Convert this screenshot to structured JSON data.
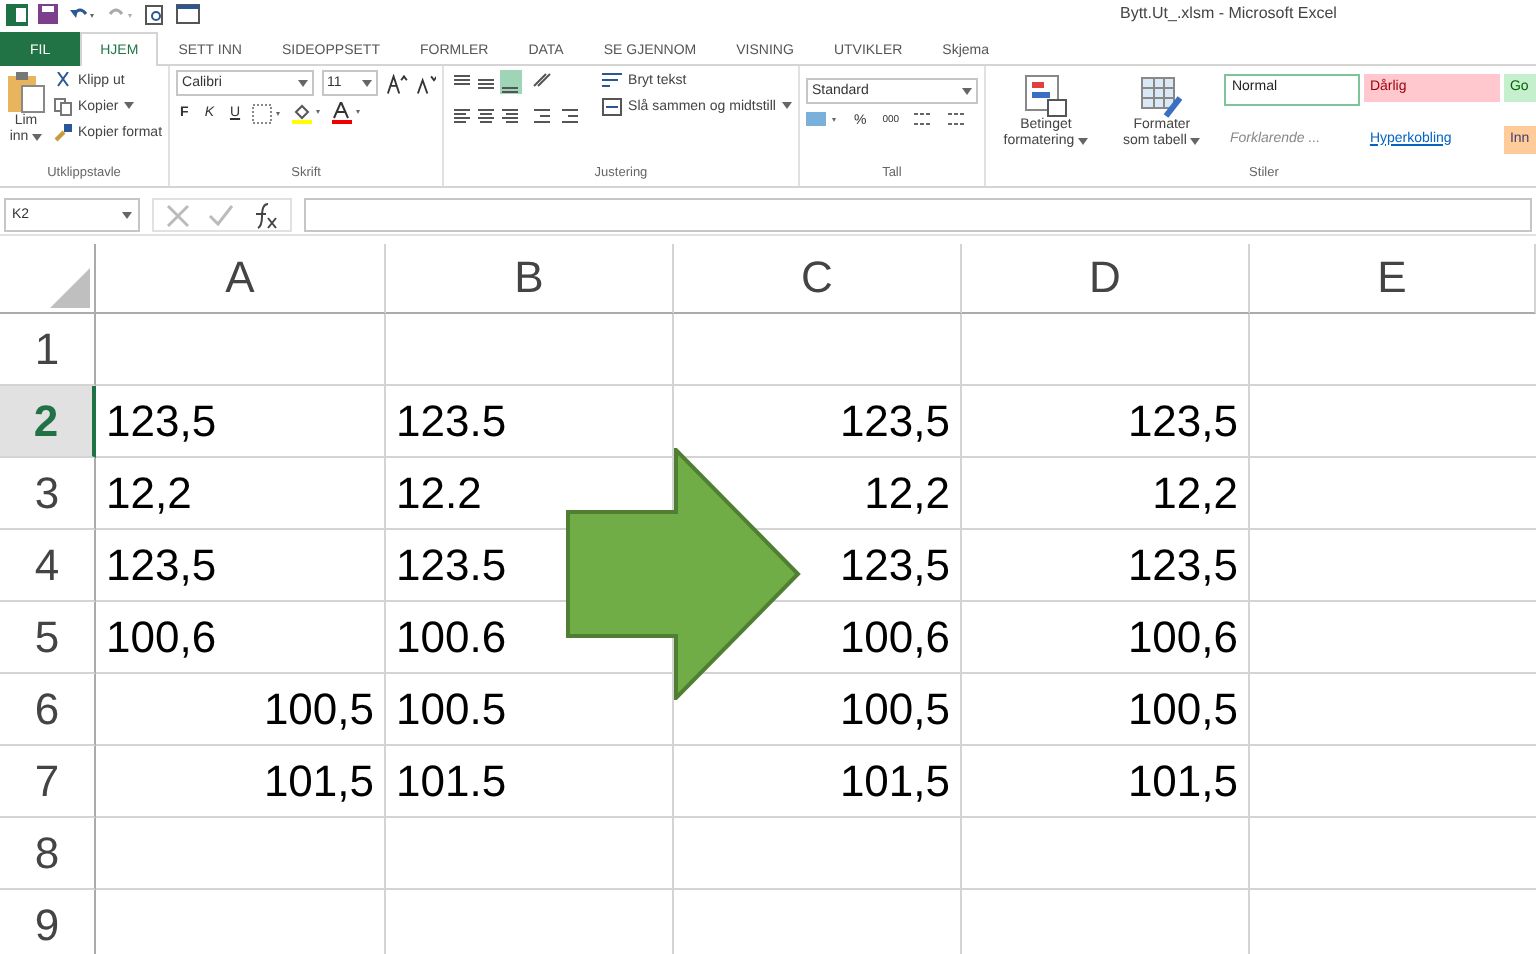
{
  "window": {
    "title": "Bytt.Ut_.xlsm - Microsoft Excel"
  },
  "tabs": [
    {
      "label": "FIL",
      "kind": "file",
      "selected": false
    },
    {
      "label": "HJEM",
      "kind": "tab",
      "selected": true
    },
    {
      "label": "SETT INN",
      "kind": "tab",
      "selected": false
    },
    {
      "label": "SIDEOPPSETT",
      "kind": "tab",
      "selected": false
    },
    {
      "label": "FORMLER",
      "kind": "tab",
      "selected": false
    },
    {
      "label": "DATA",
      "kind": "tab",
      "selected": false
    },
    {
      "label": "SE GJENNOM",
      "kind": "tab",
      "selected": false
    },
    {
      "label": "VISNING",
      "kind": "tab",
      "selected": false
    },
    {
      "label": "UTVIKLER",
      "kind": "tab",
      "selected": false
    },
    {
      "label": "Skjema",
      "kind": "tab",
      "selected": false
    }
  ],
  "ribbon": {
    "clipboard": {
      "paste": "Lim",
      "paste2": "inn",
      "cut": "Klipp ut",
      "copy": "Kopier",
      "format_painter": "Kopier format",
      "label": "Utklippstavle"
    },
    "font": {
      "name": "Calibri",
      "size": "11",
      "bold": "F",
      "italic": "K",
      "underline": "U",
      "label": "Skrift"
    },
    "alignment": {
      "wrap": "Bryt tekst",
      "merge": "Slå sammen og midtstill",
      "label": "Justering"
    },
    "number": {
      "format": "Standard",
      "percent": "%",
      "thousands": "000",
      "label": "Tall"
    },
    "styles": {
      "conditional": [
        "Betinget",
        "formatering"
      ],
      "as_table": [
        "Formater",
        "som tabell"
      ],
      "label": "Stiler",
      "cells": [
        {
          "label": "Normal",
          "color": "#ffffff",
          "kind": "normal"
        },
        {
          "label": "Dårlig",
          "color": "#ffc7ce",
          "kind": "bad"
        },
        {
          "label": "Go",
          "color": "#c6efce",
          "kind": "good"
        },
        {
          "label": "Forklarende ...",
          "color": "#ffffff",
          "kind": "explanatory"
        },
        {
          "label": "Hyperkobling",
          "color": "#ffffff",
          "kind": "link"
        },
        {
          "label": "Inn",
          "color": "#ffcc99",
          "kind": "input"
        }
      ]
    }
  },
  "formula_bar": {
    "name_box": "K2"
  },
  "sheet": {
    "columns": [
      {
        "label": "A"
      },
      {
        "label": "B"
      },
      {
        "label": "C"
      },
      {
        "label": "D"
      },
      {
        "label": "E"
      }
    ],
    "rows": [
      {
        "label": "1",
        "selected": false,
        "cells": []
      },
      {
        "label": "2",
        "selected": true,
        "cells": [
          {
            "value": "123,5",
            "kind": "text"
          },
          {
            "value": "123.5",
            "kind": "text"
          },
          {
            "value": "123,5",
            "kind": "number"
          },
          {
            "value": "123,5",
            "kind": "number"
          }
        ]
      },
      {
        "label": "3",
        "selected": false,
        "cells": [
          {
            "value": "12,2",
            "kind": "text"
          },
          {
            "value": "12.2",
            "kind": "text"
          },
          {
            "value": "12,2",
            "kind": "number"
          },
          {
            "value": "12,2",
            "kind": "number"
          }
        ]
      },
      {
        "label": "4",
        "selected": false,
        "cells": [
          {
            "value": "123,5",
            "kind": "text"
          },
          {
            "value": "123.5",
            "kind": "text"
          },
          {
            "value": "123,5",
            "kind": "number"
          },
          {
            "value": "123,5",
            "kind": "number"
          }
        ]
      },
      {
        "label": "5",
        "selected": false,
        "cells": [
          {
            "value": "100,6",
            "kind": "text"
          },
          {
            "value": "100.6",
            "kind": "text"
          },
          {
            "value": "100,6",
            "kind": "number"
          },
          {
            "value": "100,6",
            "kind": "number"
          }
        ]
      },
      {
        "label": "6",
        "selected": false,
        "cells": [
          {
            "value": "100,5",
            "kind": "number"
          },
          {
            "value": "100.5",
            "kind": "text"
          },
          {
            "value": "100,5",
            "kind": "number"
          },
          {
            "value": "100,5",
            "kind": "number"
          }
        ]
      },
      {
        "label": "7",
        "selected": false,
        "cells": [
          {
            "value": "101,5",
            "kind": "number"
          },
          {
            "value": "101.5",
            "kind": "text"
          },
          {
            "value": "101,5",
            "kind": "number"
          },
          {
            "value": "101,5",
            "kind": "number"
          }
        ]
      },
      {
        "label": "8",
        "selected": false,
        "cells": []
      },
      {
        "label": "9",
        "selected": false,
        "cells": []
      }
    ]
  }
}
